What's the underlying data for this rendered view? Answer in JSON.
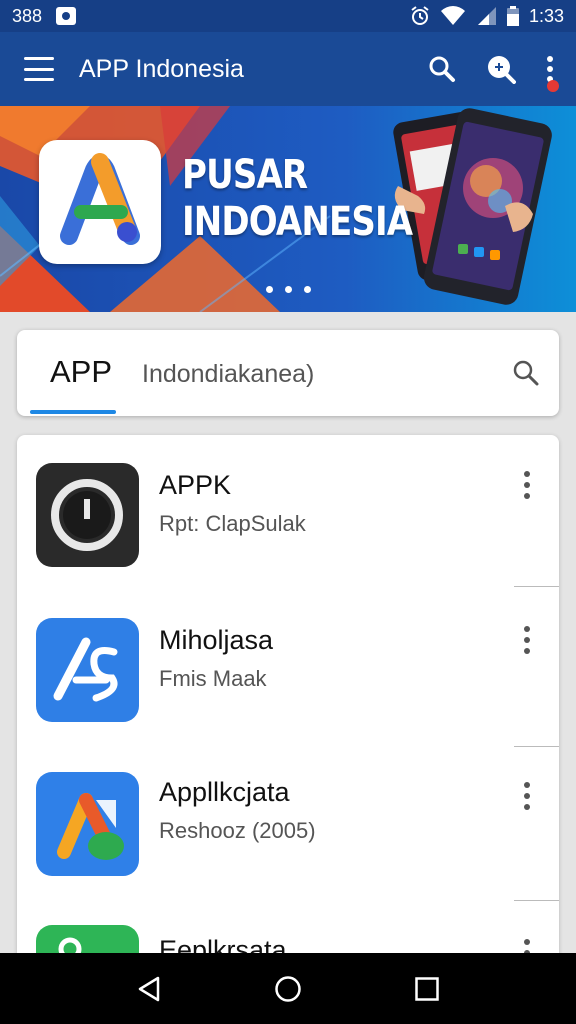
{
  "status": {
    "left_text": "388",
    "time": "1:33",
    "icons": [
      "notification-icon",
      "alarm-icon",
      "wifi-icon",
      "signal-icon",
      "battery-icon"
    ]
  },
  "app_bar": {
    "title": "APP Indonesia",
    "icons": [
      "menu-icon",
      "search-icon",
      "zoom-icon",
      "overflow-icon"
    ]
  },
  "banner": {
    "title_line1": "PUSAR",
    "title_line2": "INDOANESIA",
    "page_indicator_count": 3
  },
  "tabs": {
    "active": "APP",
    "inactive": "Indondiakanea)"
  },
  "apps": [
    {
      "name": "APPK",
      "subtitle": "Rpt: ClapSulak",
      "icon": "clock-app-icon"
    },
    {
      "name": "Miholjasa",
      "subtitle": "Fmis Maak",
      "icon": "blue-a-app-icon"
    },
    {
      "name": "Appllkcjata",
      "subtitle": "Reshooz (2005)",
      "icon": "colorful-a-app-icon"
    },
    {
      "name": "Eeplkrsata",
      "subtitle": "",
      "icon": "green-app-icon"
    }
  ],
  "colors": {
    "primary": "#1a4a96",
    "status_bar": "#163f86",
    "accent": "#1e88e5",
    "badge": "#e53935"
  }
}
